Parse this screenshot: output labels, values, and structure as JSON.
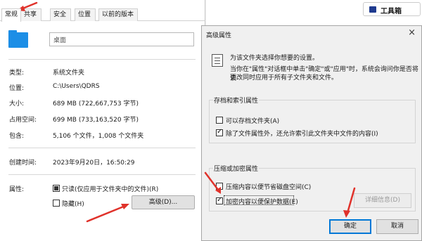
{
  "props": {
    "tabs": [
      "常规",
      "共享",
      "安全",
      "位置",
      "以前的版本"
    ],
    "name": "桌面",
    "rows": [
      {
        "label": "类型:",
        "value": "系统文件夹"
      },
      {
        "label": "位置:",
        "value": "C:\\Users\\QDRS"
      },
      {
        "label": "大小:",
        "value": "689 MB (722,667,753 字节)"
      },
      {
        "label": "占用空间:",
        "value": "699 MB (733,163,520 字节)"
      },
      {
        "label": "包含:",
        "value": "5,106 个文件，1,008 个文件夹"
      }
    ],
    "created": {
      "label": "创建时间:",
      "value": "2023年9月20日，16:50:29"
    },
    "attributes_label": "属性:",
    "readonly_label": "只读(仅应用于文件夹中的文件)(R)",
    "hidden_label": "隐藏(H)",
    "advanced_button": "高级(D)..."
  },
  "toolbox": {
    "label": "工具箱",
    "icon": "toolbox-icon"
  },
  "dialog": {
    "title": "高级属性",
    "close": "×",
    "info_line1": "为该文件夹选择你想要的设置。",
    "info_line2": "当你在\"属性\"对话框中单击\"确定\"或\"应用\"时，系统会询问你是否将该",
    "info_line3": "更改同时应用于所有子文件夹和文件。",
    "archive_group": "存档和索引属性",
    "archive_opt": "可以存档文件夹(A)",
    "index_opt": "除了文件属性外，还允许索引此文件夹中文件的内容(I)",
    "compress_group": "压缩或加密属性",
    "compress_opt": "压缩内容以便节省磁盘空间(C)",
    "encrypt_opt": "加密内容以便保护数据(E)",
    "details_button": "详细信息(D)",
    "ok_button": "确定",
    "cancel_button": "取消"
  },
  "colors": {
    "accent": "#0078d7",
    "arrow": "#e0322b",
    "folder": "#1c8ee6"
  }
}
